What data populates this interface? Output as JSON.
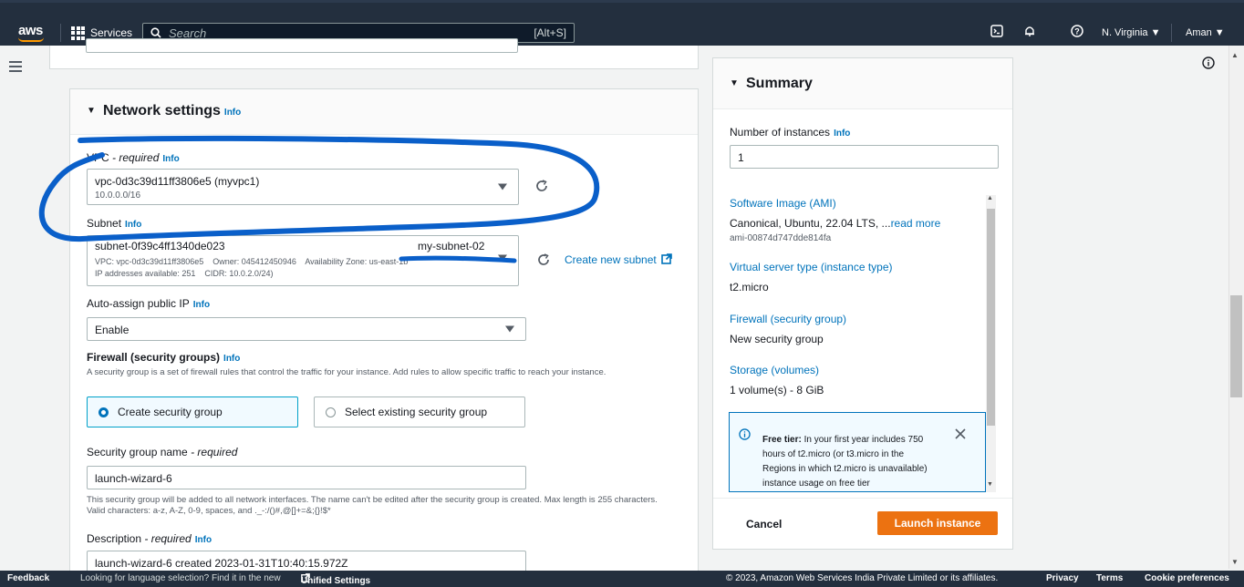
{
  "nav": {
    "logo": "aws",
    "services": "Services",
    "search_placeholder": "Search",
    "search_shortcut": "[Alt+S]",
    "region": "N. Virginia ▼",
    "user": "Aman ▼"
  },
  "network": {
    "title": "Network settings",
    "title_info": "Info",
    "vpc_label": "VPC",
    "vpc_required": " - required",
    "vpc_info": "Info",
    "vpc_value": "vpc-0d3c39d11ff3806e5 (myvpc1)",
    "vpc_cidr": "10.0.0.0/16",
    "subnet_label": "Subnet",
    "subnet_info": "Info",
    "subnet_id": "subnet-0f39c4ff1340de023",
    "subnet_name": "my-subnet-02",
    "subnet_detail1": "VPC: vpc-0d3c39d11ff3806e5    Owner: 045412450946    Availability Zone: us-east-1b",
    "subnet_detail2": "IP addresses available: 251    CIDR: 10.0.2.0/24)",
    "create_subnet": "Create new subnet",
    "public_ip_label": "Auto-assign public IP",
    "public_ip_info": "Info",
    "public_ip_value": "Enable",
    "firewall_label": "Firewall (security groups)",
    "firewall_info": "Info",
    "firewall_desc": "A security group is a set of firewall rules that control the traffic for your instance. Add rules to allow specific traffic to reach your instance.",
    "opt_create": "Create security group",
    "opt_select": "Select existing security group",
    "sg_name_label": "Security group name",
    "sg_name_required": " - required",
    "sg_name_value": "launch-wizard-6",
    "sg_name_hint": "This security group will be added to all network interfaces. The name can't be edited after the security group is created. Max length is 255 characters. Valid characters: a-z, A-Z, 0-9, spaces, and ._-:/()#,@[]+=&;{}!$*",
    "desc_label": "Description",
    "desc_required": " - required",
    "desc_info": "Info",
    "desc_value": "launch-wizard-6 created 2023-01-31T10:40:15.972Z"
  },
  "summary": {
    "title": "Summary",
    "num_label": "Number of instances",
    "num_info": "Info",
    "num_value": "1",
    "ami_label": "Software Image (AMI)",
    "ami_value": "Canonical, Ubuntu, 22.04 LTS, ...",
    "ami_more": "read more",
    "ami_id": "ami-00874d747dde814fa",
    "type_label": "Virtual server type (instance type)",
    "type_value": "t2.micro",
    "fw_label": "Firewall (security group)",
    "fw_value": "New security group",
    "storage_label": "Storage (volumes)",
    "storage_value": "1 volume(s) - 8 GiB",
    "free_tier_bold": "Free tier:",
    "free_tier_text": " In your first year includes 750 hours of t2.micro (or t3.micro in the Regions in which t2.micro is unavailable) instance usage on free tier",
    "cancel": "Cancel",
    "launch": "Launch instance"
  },
  "footer": {
    "feedback": "Feedback",
    "lang_prompt": "Looking for language selection? Find it in the new",
    "unified": "Unified Settings",
    "copyright": "© 2023, Amazon Web Services India Private Limited or its affiliates.",
    "privacy": "Privacy",
    "terms": "Terms",
    "cookies": "Cookie preferences"
  },
  "colors": {
    "nav_bg": "#232f3e",
    "accent": "#ec7211",
    "link": "#0073bb",
    "annotation": "#0a5fc9"
  }
}
